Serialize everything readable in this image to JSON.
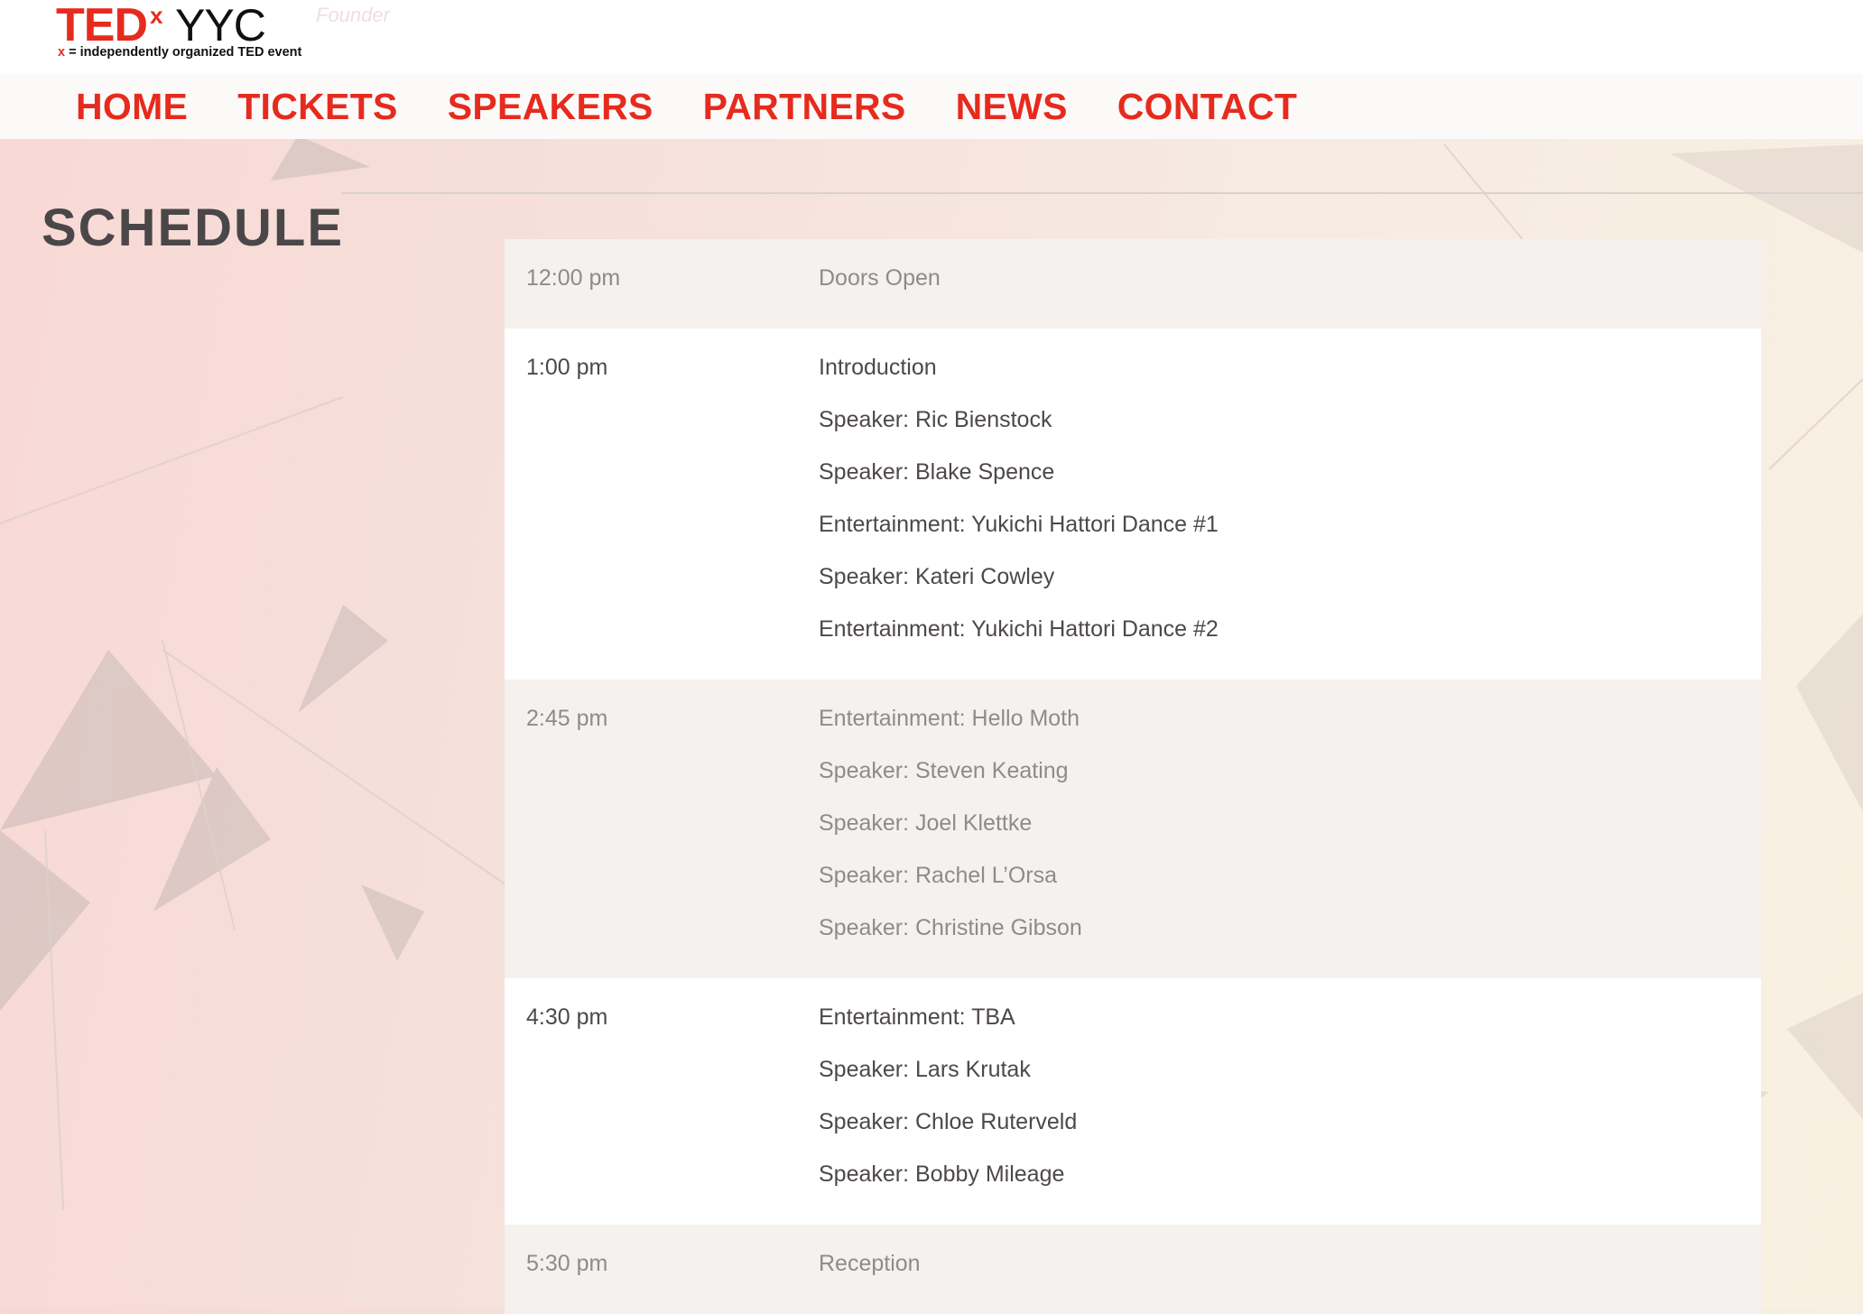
{
  "logo": {
    "brand": "TED",
    "superscript": "x",
    "city": "YYC",
    "tagline_x": "x",
    "tagline": " = independently organized TED event",
    "ghost_text": "Founder"
  },
  "nav": {
    "items": [
      "HOME",
      "TICKETS",
      "SPEAKERS",
      "PARTNERS",
      "NEWS",
      "CONTACT"
    ]
  },
  "page": {
    "title": "SCHEDULE"
  },
  "schedule": [
    {
      "time": "12:00 pm",
      "events": [
        "Doors Open"
      ]
    },
    {
      "time": "1:00 pm",
      "events": [
        "Introduction",
        "Speaker: Ric Bienstock",
        "Speaker: Blake Spence",
        "Entertainment: Yukichi Hattori Dance #1",
        "Speaker: Kateri Cowley",
        "Entertainment: Yukichi Hattori Dance #2"
      ]
    },
    {
      "time": "2:45 pm",
      "events": [
        "Entertainment: Hello Moth",
        "Speaker: Steven Keating",
        "Speaker: Joel Klettke",
        "Speaker: Rachel L’Orsa",
        "Speaker: Christine Gibson"
      ]
    },
    {
      "time": "4:30 pm",
      "events": [
        "Entertainment: TBA",
        "Speaker: Lars Krutak",
        "Speaker: Chloe Ruterveld",
        "Speaker: Bobby Mileage"
      ]
    },
    {
      "time": "5:30 pm",
      "events": [
        "Reception"
      ]
    }
  ],
  "colors": {
    "accent": "#e62b1e",
    "title": "#4a4748",
    "row_shaded": "#f4f1ef",
    "row_white": "#ffffff"
  }
}
